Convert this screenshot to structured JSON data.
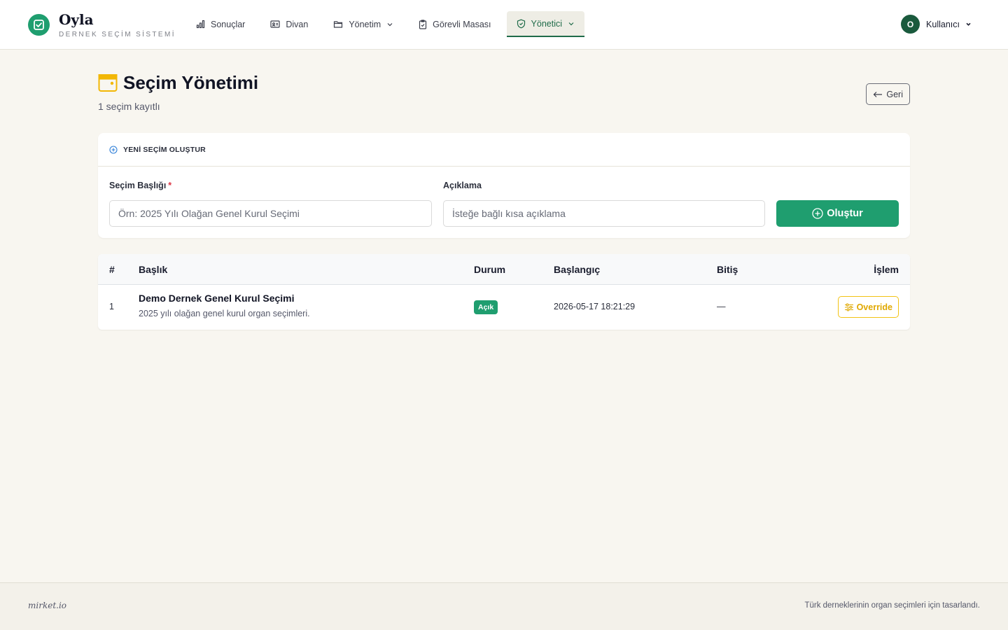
{
  "app": {
    "name": "Oyla",
    "subtitle": "DERNEK SEÇİM SİSTEMİ"
  },
  "nav": {
    "items": [
      {
        "label": "Sonuçlar",
        "icon": "bar-chart-icon"
      },
      {
        "label": "Divan",
        "icon": "id-card-icon"
      },
      {
        "label": "Yönetim",
        "icon": "folder-icon",
        "dropdown": true
      },
      {
        "label": "Görevli Masası",
        "icon": "clipboard-check-icon"
      },
      {
        "label": "Yönetici",
        "icon": "shield-icon",
        "dropdown": true,
        "active": true
      }
    ]
  },
  "user": {
    "initial": "O",
    "name": "Kullanıcı"
  },
  "page": {
    "title": "Seçim Yönetimi",
    "subtitle": "1 seçim kayıtlı",
    "back_label": "Geri"
  },
  "create_form": {
    "heading": "YENİ SEÇİM OLUŞTUR",
    "title_label": "Seçim Başlığı",
    "required_mark": "*",
    "title_placeholder": "Örn: 2025 Yılı Olağan Genel Kurul Seçimi",
    "title_value": "",
    "desc_label": "Açıklama",
    "desc_placeholder": "İsteğe bağlı kısa açıklama",
    "desc_value": "",
    "submit_label": "Oluştur"
  },
  "table": {
    "headers": {
      "index": "#",
      "title": "Başlık",
      "status": "Durum",
      "start": "Başlangıç",
      "end": "Bitiş",
      "action": "İşlem"
    },
    "rows": [
      {
        "index": "1",
        "title": "Demo Dernek Genel Kurul Seçimi",
        "description": "2025 yılı olağan genel kurul organ seçimleri.",
        "status": "Açık",
        "start": "2026-05-17 18:21:29",
        "end": "—",
        "action_label": "Override"
      }
    ]
  },
  "footer": {
    "left": "mirket.io",
    "right": "Türk derneklerinin organ seçimleri için tasarlandı."
  },
  "colors": {
    "primary": "#1f9e6f",
    "primary_dark": "#1a5a3d",
    "accent_yellow": "#f2c314",
    "background": "#f8f6f0",
    "danger": "#dc3545"
  }
}
